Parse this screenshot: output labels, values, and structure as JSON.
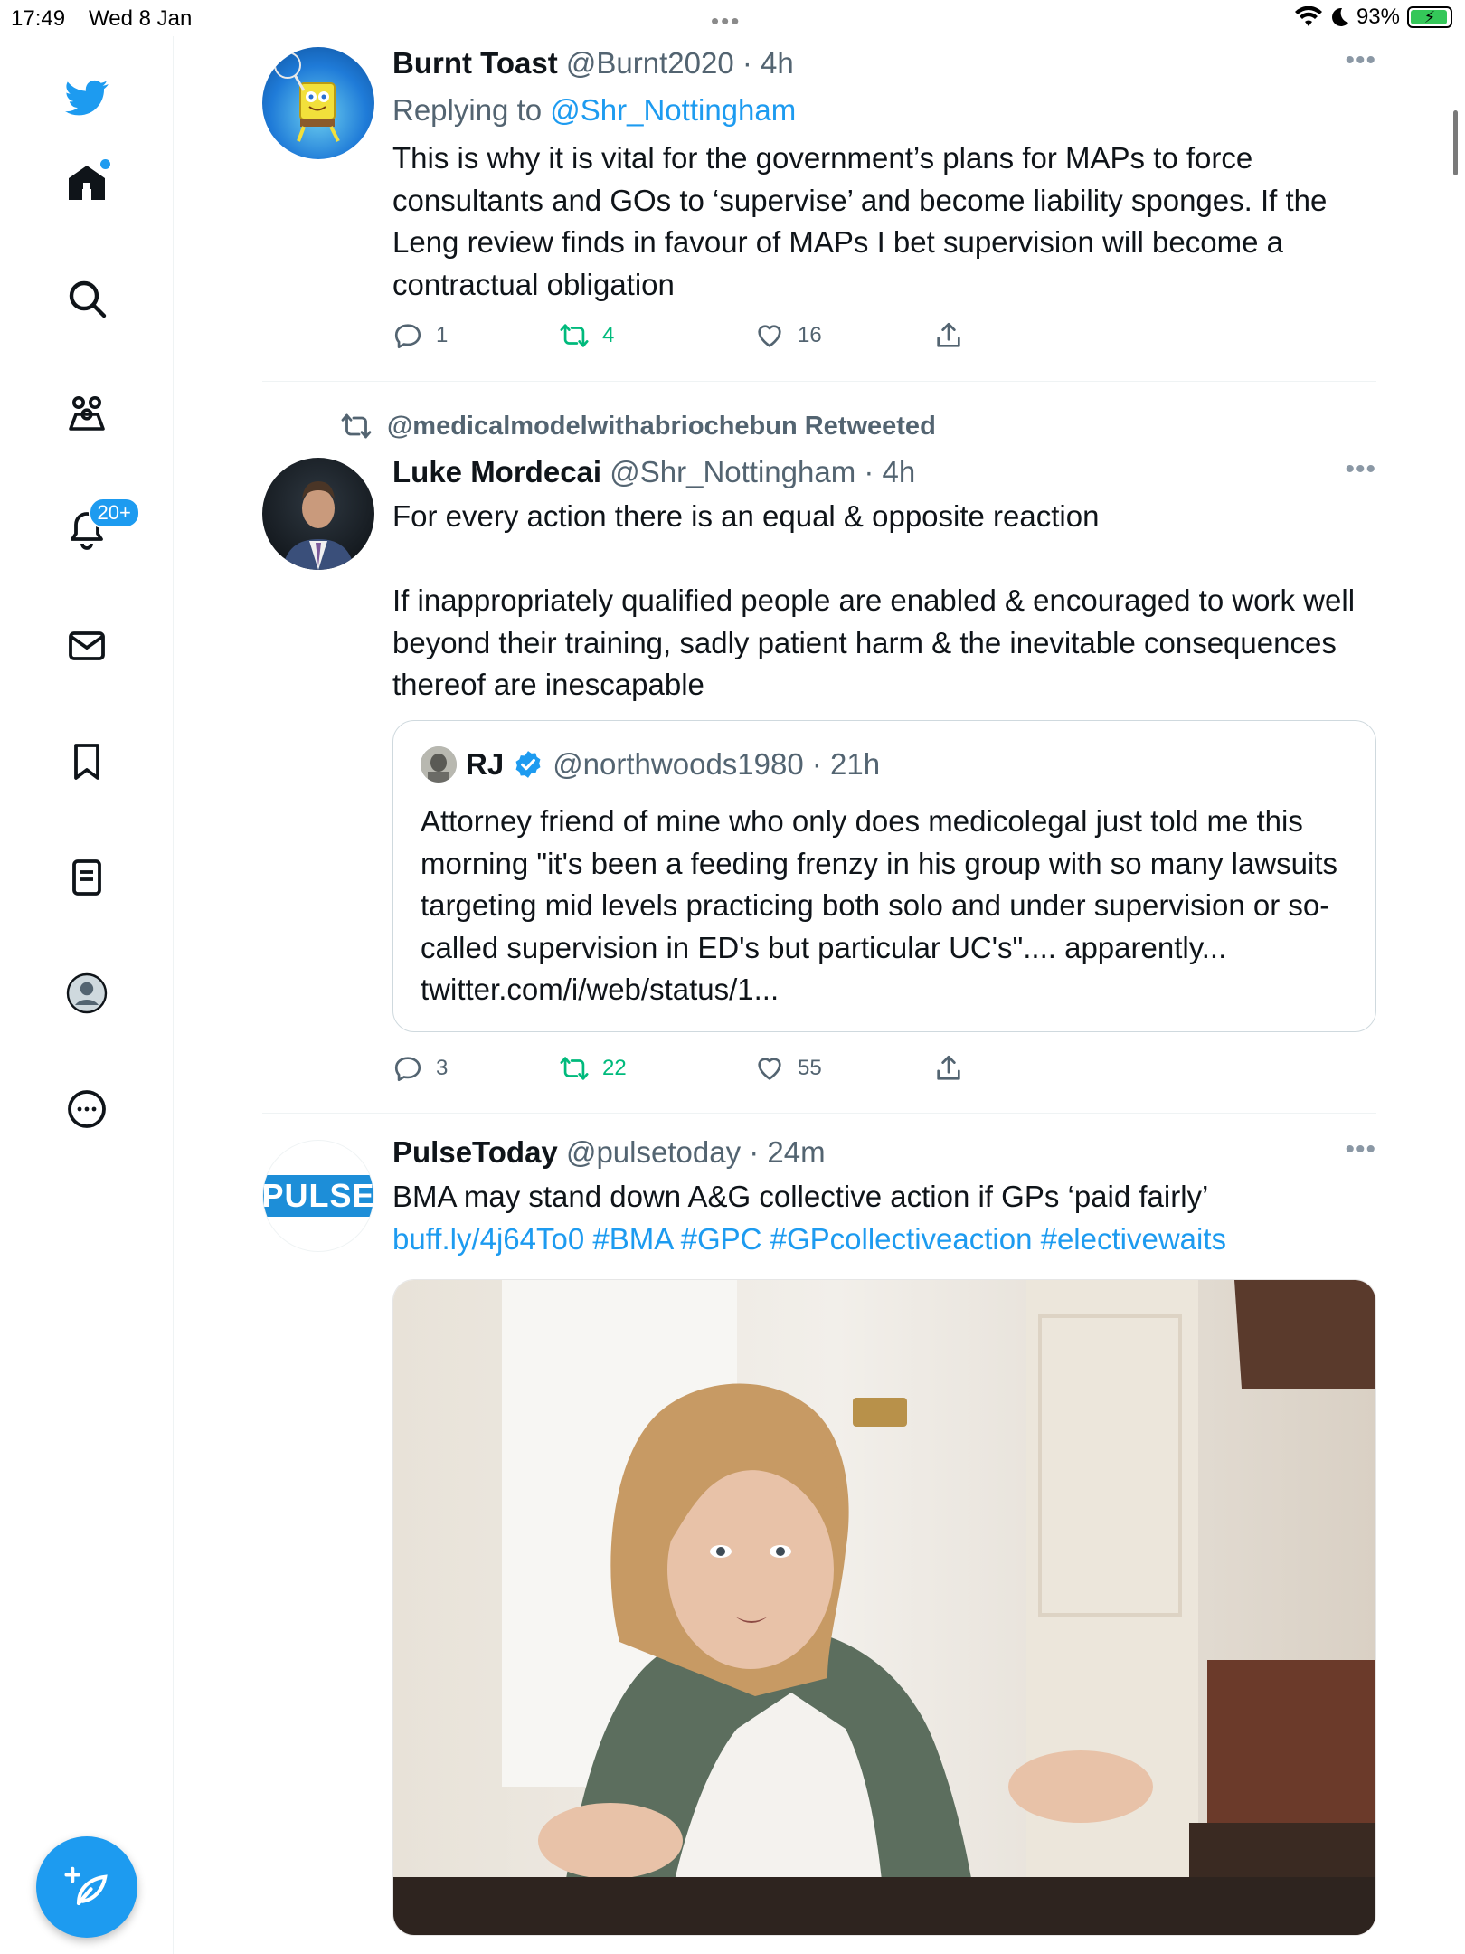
{
  "status_bar": {
    "time": "17:49",
    "date": "Wed 8 Jan",
    "battery": "93%"
  },
  "sidebar": {
    "notification_badge": "20+",
    "items": [
      {
        "icon": "twitter-bird-icon"
      },
      {
        "icon": "home-icon"
      },
      {
        "icon": "search-icon"
      },
      {
        "icon": "communities-icon"
      },
      {
        "icon": "notifications-bell-icon"
      },
      {
        "icon": "messages-envelope-icon"
      },
      {
        "icon": "bookmark-icon"
      },
      {
        "icon": "lists-icon"
      },
      {
        "icon": "profile-avatar-icon"
      },
      {
        "icon": "more-options-icon"
      }
    ],
    "compose_icon": "compose-feather-icon"
  },
  "colors": {
    "accent": "#1d9bf0",
    "retweet_green": "#00ba7c",
    "secondary_text": "#536471",
    "border": "#eff3f4"
  },
  "tweets": [
    {
      "name": "Burnt Toast",
      "handle": "@Burnt2020",
      "sep": " · ",
      "ago": "4h",
      "replying_prefix": "Replying to ",
      "replying_to": "@Shr_Nottingham",
      "text": "This is why it is vital for the government’s plans for MAPs to force consultants and GOs to ‘supervise’ and become liability sponges. If the Leng review finds in favour of MAPs I bet supervision will become a contractual obligation",
      "replies": "1",
      "retweets": "4",
      "likes": "16"
    },
    {
      "retweeted_by": "@medicalmodelwithabriochebun Retweeted",
      "name": "Luke Mordecai",
      "handle": "@Shr_Nottingham",
      "sep": " · ",
      "ago": "4h",
      "text": "For every action there is an equal & opposite reaction\n\nIf inappropriately qualified people are enabled & encouraged to work well beyond their training, sadly patient harm & the inevitable consequences thereof are inescapable",
      "quote": {
        "name": "RJ",
        "handle": "@northwoods1980",
        "sep": " · ",
        "ago": "21h",
        "text": "Attorney friend of mine who only does medicolegal just told me this morning \"it's been a feeding frenzy in his group with so many lawsuits targeting mid levels practicing both solo and under supervision or so-called supervision in ED's but particular UC's\".... apparently... twitter.com/i/web/status/1..."
      },
      "replies": "3",
      "retweets": "22",
      "likes": "55"
    },
    {
      "name": "PulseToday",
      "handle": "@pulsetoday",
      "sep": " · ",
      "ago": "24m",
      "avatar_text": "PULSE",
      "text_plain": "BMA may stand down A&G collective action if GPs ‘paid fairly’ ",
      "text_link": "buff.ly/4j64To0 #BMA #GPC #GPcollectiveaction #electivewaits"
    }
  ]
}
